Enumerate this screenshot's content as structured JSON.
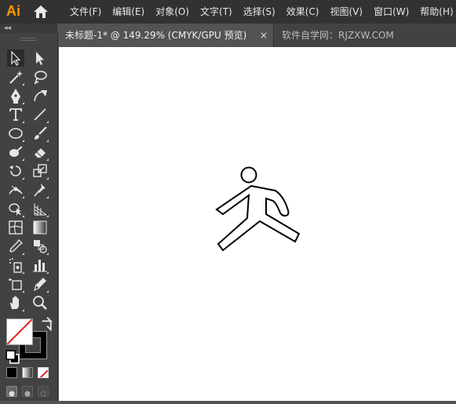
{
  "app": {
    "logo": "Ai"
  },
  "menu": [
    "文件(F)",
    "编辑(E)",
    "对象(O)",
    "文字(T)",
    "选择(S)",
    "效果(C)",
    "视图(V)",
    "窗口(W)",
    "帮助(H)"
  ],
  "tabs": {
    "active": "未标题-1* @ 149.29% (CMYK/GPU 预览)",
    "close": "×",
    "inactive": "软件自学网：RJZXW.COM"
  },
  "panel": {
    "collapse": "◂◂"
  },
  "tools": [
    {
      "name": "selection-tool-icon"
    },
    {
      "name": "direct-selection-tool-icon"
    },
    {
      "name": "magic-wand-tool-icon"
    },
    {
      "name": "lasso-tool-icon"
    },
    {
      "name": "pen-tool-icon"
    },
    {
      "name": "curvature-tool-icon"
    },
    {
      "name": "type-tool-icon"
    },
    {
      "name": "line-segment-tool-icon"
    },
    {
      "name": "ellipse-tool-icon"
    },
    {
      "name": "paintbrush-tool-icon"
    },
    {
      "name": "shaper-tool-icon"
    },
    {
      "name": "eraser-tool-icon"
    },
    {
      "name": "rotate-tool-icon"
    },
    {
      "name": "scale-tool-icon"
    },
    {
      "name": "width-tool-icon"
    },
    {
      "name": "puppet-warp-tool-icon"
    },
    {
      "name": "shape-builder-tool-icon"
    },
    {
      "name": "perspective-grid-tool-icon"
    },
    {
      "name": "mesh-tool-icon"
    },
    {
      "name": "gradient-tool-icon"
    },
    {
      "name": "eyedropper-tool-icon"
    },
    {
      "name": "blend-tool-icon"
    },
    {
      "name": "symbol-sprayer-tool-icon"
    },
    {
      "name": "column-graph-tool-icon"
    },
    {
      "name": "artboard-tool-icon"
    },
    {
      "name": "slice-tool-icon"
    },
    {
      "name": "hand-tool-icon"
    },
    {
      "name": "zoom-tool-icon"
    }
  ],
  "colors": {
    "accent": "#ff9a00",
    "canvas": "#ffffff",
    "stroke": "#000000",
    "none_slash": "#e02020"
  }
}
